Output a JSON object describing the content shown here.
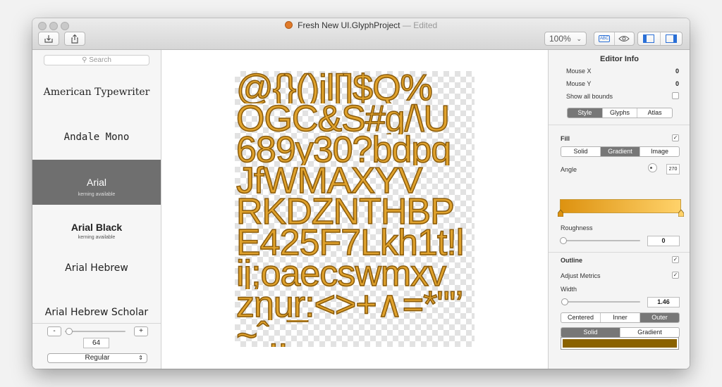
{
  "window": {
    "title": "Fresh New UI.GlyphProject",
    "title_separator": "—",
    "title_status": "Edited"
  },
  "toolbar": {
    "left_buttons": [
      {
        "icon": "export-icon"
      },
      {
        "icon": "share-icon"
      }
    ],
    "zoom_value": "100%",
    "view_buttons": [
      {
        "icon": "abc-icon",
        "label": "ABC"
      },
      {
        "icon": "eye-icon"
      }
    ],
    "panel_buttons": [
      {
        "icon": "left-panel-icon"
      },
      {
        "icon": "right-panel-icon"
      }
    ]
  },
  "sidebar": {
    "search_placeholder": "Search",
    "fonts": [
      {
        "name": "American Typewriter",
        "kerning": ""
      },
      {
        "name": "Andale Mono",
        "kerning": ""
      },
      {
        "name": "Arial",
        "kerning": "kerning available",
        "selected": true
      },
      {
        "name": "Arial Black",
        "kerning": "kerning available"
      },
      {
        "name": "Arial Hebrew",
        "kerning": ""
      },
      {
        "name": "Arial Hebrew Scholar",
        "kerning": ""
      }
    ],
    "size_minus": "-",
    "size_plus": "+",
    "font_size": "64",
    "font_size_fraction": 0.07,
    "style_value": "Regular"
  },
  "canvas": {
    "glyph_rows": [
      "@{}()jl[]$Q%",
      "OGC&S#g/\\U",
      "689y30?bdpq",
      "JfWMAXYV",
      "RKDZNTHBP",
      "E425F7Lkh1t!l",
      "ij;oaecswmxv",
      "zηur:<>+∧=*\"'’",
      "~ˆ..¯_"
    ],
    "fill_color": "#e0a22c",
    "outline_color": "#8a5b0c"
  },
  "inspector": {
    "editor_info_title": "Editor Info",
    "mouse_x_label": "Mouse X",
    "mouse_x_value": "0",
    "mouse_y_label": "Mouse Y",
    "mouse_y_value": "0",
    "show_bounds_label": "Show all bounds",
    "tabs": [
      "Style",
      "Glyphs",
      "Atlas"
    ],
    "active_tab": "Style",
    "fill_label": "Fill",
    "fill_modes": [
      "Solid",
      "Gradient",
      "Image"
    ],
    "fill_active_mode": "Gradient",
    "angle_label": "Angle",
    "angle_value": "270",
    "gradient_start_color": "#dd9210",
    "gradient_end_color": "#ffd26a",
    "roughness_label": "Roughness",
    "roughness_value": "0",
    "outline_label": "Outline",
    "adjust_metrics_label": "Adjust Metrics",
    "width_label": "Width",
    "width_value": "1.46",
    "outline_positions": [
      "Centered",
      "Inner",
      "Outer"
    ],
    "outline_active_position": "Outer",
    "outline_modes": [
      "Solid",
      "Gradient"
    ],
    "outline_active_mode": "Solid",
    "outline_swatch_color": "#8a6200"
  }
}
